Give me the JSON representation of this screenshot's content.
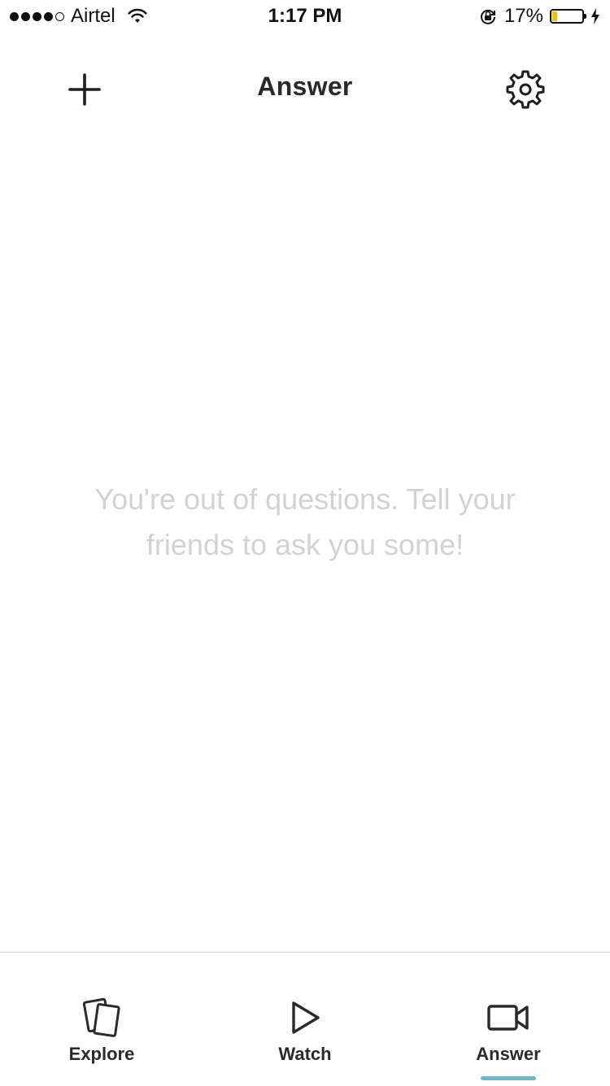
{
  "status_bar": {
    "carrier": "Airtel",
    "time": "1:17 PM",
    "battery_text": "17%",
    "battery_level": 0.17,
    "battery_color": "#f2c200"
  },
  "header": {
    "title": "Answer",
    "add_icon": "plus-icon",
    "settings_icon": "gear-icon"
  },
  "empty_state": {
    "message": "You're out of questions. Tell your friends to ask you some!"
  },
  "tabs": [
    {
      "label": "Explore",
      "icon": "cards-icon",
      "active": false
    },
    {
      "label": "Watch",
      "icon": "play-icon",
      "active": false
    },
    {
      "label": "Answer",
      "icon": "video-camera-icon",
      "active": true
    }
  ],
  "colors": {
    "accent": "#6eb7c4",
    "empty_text": "#d2d2d2"
  }
}
